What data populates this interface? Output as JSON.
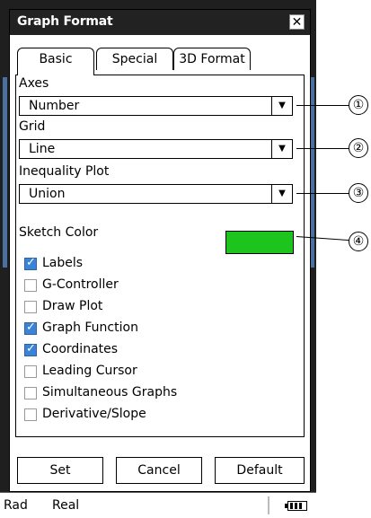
{
  "dialog": {
    "title": "Graph Format",
    "close_glyph": "✕"
  },
  "tabs": [
    {
      "label": "Basic",
      "active": true
    },
    {
      "label": "Special",
      "active": false
    },
    {
      "label": "3D Format",
      "active": false
    }
  ],
  "fields": {
    "axes": {
      "label": "Axes",
      "value": "Number"
    },
    "grid": {
      "label": "Grid",
      "value": "Line"
    },
    "inequality": {
      "label": "Inequality Plot",
      "value": "Union"
    }
  },
  "sketch_color": {
    "label": "Sketch Color",
    "color": "#1dc41d"
  },
  "checkboxes": [
    {
      "label": "Labels",
      "checked": true
    },
    {
      "label": "G-Controller",
      "checked": false
    },
    {
      "label": "Draw Plot",
      "checked": false
    },
    {
      "label": "Graph Function",
      "checked": true
    },
    {
      "label": "Coordinates",
      "checked": true
    },
    {
      "label": "Leading Cursor",
      "checked": false
    },
    {
      "label": "Simultaneous Graphs",
      "checked": false
    },
    {
      "label": "Derivative/Slope",
      "checked": false
    }
  ],
  "buttons": {
    "set": "Set",
    "cancel": "Cancel",
    "default": "Default"
  },
  "status": {
    "angle": "Rad",
    "mode": "Real"
  },
  "callouts": [
    "①",
    "②",
    "③",
    "④"
  ],
  "arrow_glyph": "▼"
}
